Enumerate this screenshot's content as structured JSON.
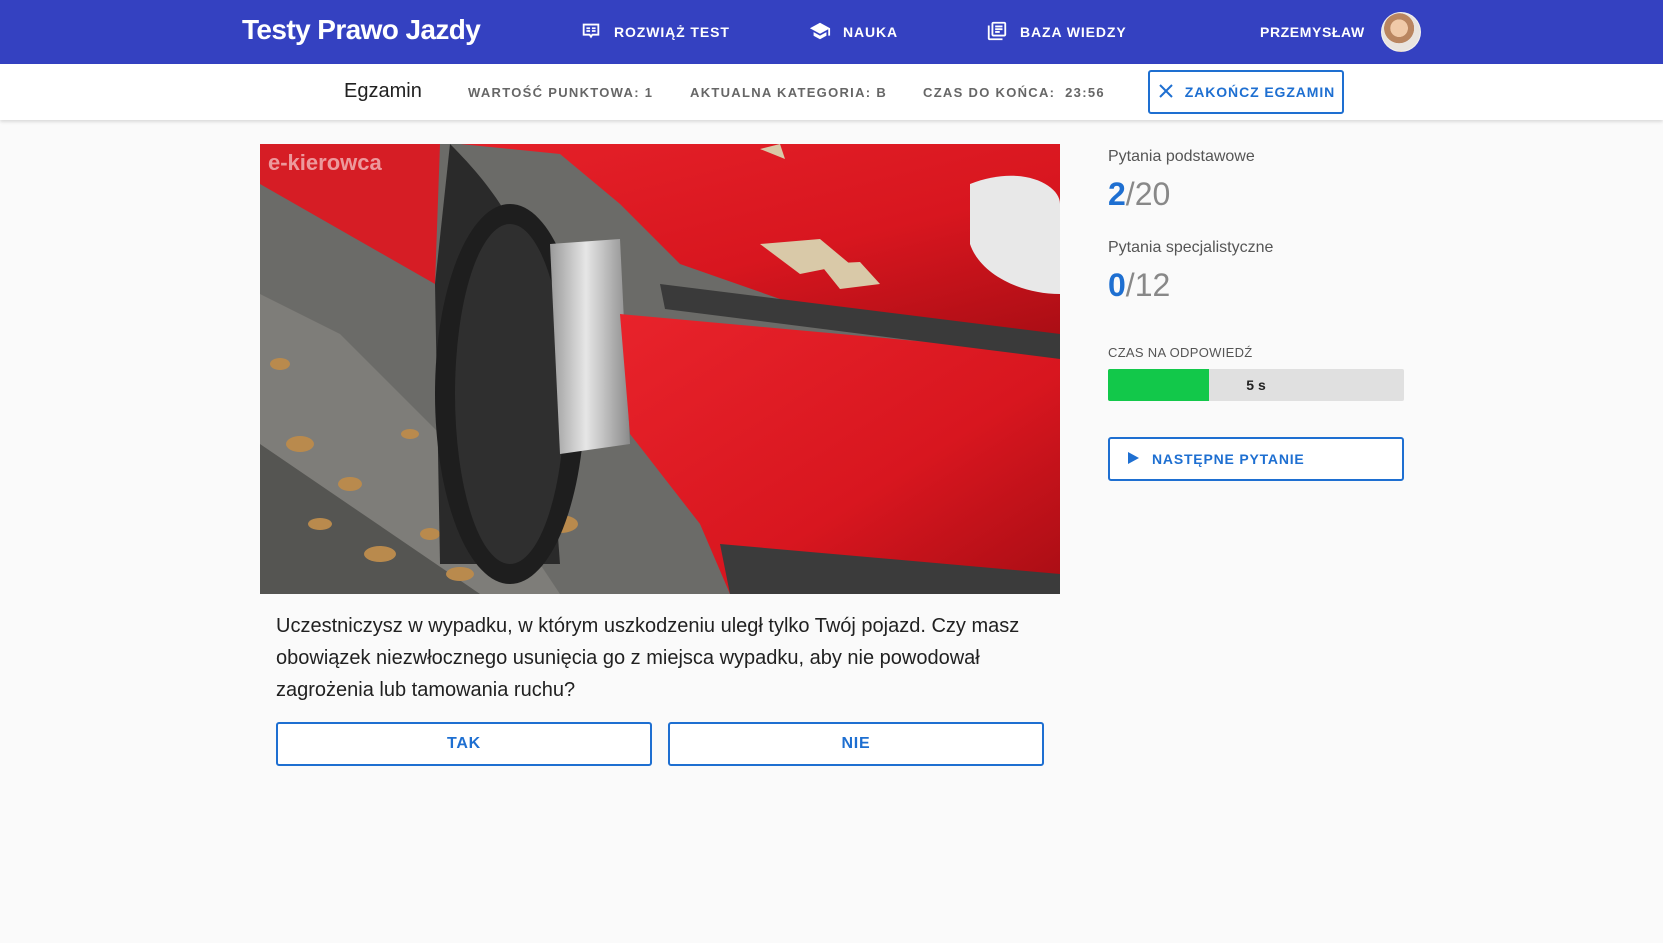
{
  "header": {
    "brand": "Testy Prawo Jazdy",
    "nav": [
      {
        "label": "ROZWIĄŻ TEST",
        "icon": "test-icon"
      },
      {
        "label": "NAUKA",
        "icon": "graduation-cap-icon"
      },
      {
        "label": "BAZA WIEDZY",
        "icon": "book-icon"
      }
    ],
    "user": {
      "name": "PRZEMYSŁAW",
      "icon": "avatar"
    }
  },
  "subheader": {
    "title": "Egzamin",
    "points": "WARTOŚĆ PUNKTOWA: 1",
    "category": "AKTUALNA KATEGORIA: B",
    "time_left": "CZAS DO KOŃCA:  23:56",
    "end_button": "ZAKOŃCZ EGZAMIN"
  },
  "question": {
    "image_watermark": "e-kierowca",
    "text": "Uczestniczysz w wypadku, w którym uszkodzeniu uległ tylko Twój pojazd. Czy masz obowiązek niezwłocznego usunięcia go z miejsca wypadku, aby nie powodował zagrożenia lub tamowania ruchu?",
    "answers": {
      "yes": "TAK",
      "no": "NIE"
    }
  },
  "sidebar": {
    "basic": {
      "label": "Pytania podstawowe",
      "current": "2",
      "total": "/20"
    },
    "specialist": {
      "label": "Pytania specjalistyczne",
      "current": "0",
      "total": "/12"
    },
    "answer_time": {
      "label": "CZAS NA ODPOWIEDŹ",
      "value_text": "5 s",
      "fraction": 0.34
    },
    "next_button": "NASTĘPNE PYTANIE"
  },
  "colors": {
    "primary_bar": "#3441c1",
    "accent": "#1e6fd1",
    "progress": "#12c84a"
  }
}
